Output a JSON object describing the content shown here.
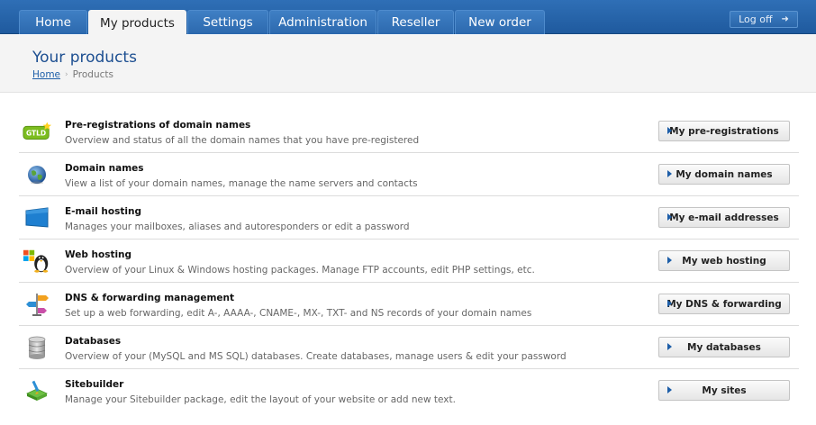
{
  "nav": {
    "tabs": [
      {
        "label": "Home",
        "active": false
      },
      {
        "label": "My products",
        "active": true
      },
      {
        "label": "Settings",
        "active": false
      },
      {
        "label": "Administration",
        "active": false
      },
      {
        "label": "Reseller",
        "active": false
      },
      {
        "label": "New order",
        "active": false
      }
    ],
    "logoff_label": "Log off"
  },
  "header": {
    "title": "Your products",
    "breadcrumb": {
      "home": "Home",
      "current": "Products"
    }
  },
  "products": [
    {
      "icon": "gtld-icon",
      "title": "Pre-registrations of domain names",
      "description": "Overview and status of all the domain names that you have pre-registered",
      "button": "My pre-registrations"
    },
    {
      "icon": "globe-icon",
      "title": "Domain names",
      "description": "View a list of your domain names, manage the name servers and contacts",
      "button": "My domain names"
    },
    {
      "icon": "mail-icon",
      "title": "E-mail hosting",
      "description": "Manages your mailboxes, aliases and autoresponders or edit a password",
      "button": "My e-mail addresses"
    },
    {
      "icon": "web-hosting-icon",
      "title": "Web hosting",
      "description": "Overview of your Linux & Windows hosting packages. Manage FTP accounts, edit PHP settings, etc.",
      "button": "My web hosting"
    },
    {
      "icon": "signpost-icon",
      "title": "DNS & forwarding management",
      "description": "Set up a web forwarding, edit A-, AAAA-, CNAME-, MX-, TXT- and NS records of your domain names",
      "button": "My DNS & forwarding"
    },
    {
      "icon": "database-icon",
      "title": "Databases",
      "description": "Overview of your (MySQL and MS SQL) databases. Create databases, manage users & edit your password",
      "button": "My databases"
    },
    {
      "icon": "sitebuilder-icon",
      "title": "Sitebuilder",
      "description": "Manage your Sitebuilder package, edit the layout of your website or add new text.",
      "button": "My sites"
    }
  ],
  "colors": {
    "nav_blue": "#1f5a9e",
    "title_blue": "#1d4f91",
    "link_blue": "#1d5ea8"
  }
}
